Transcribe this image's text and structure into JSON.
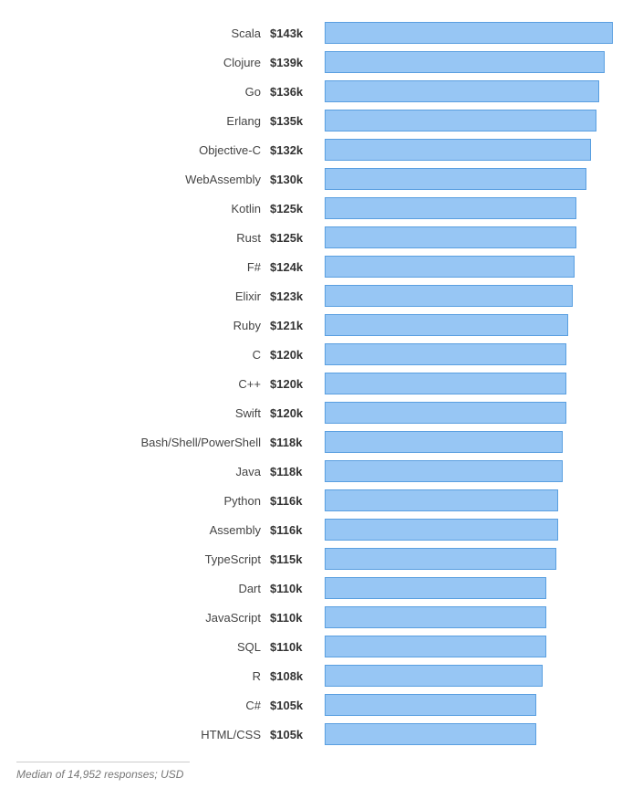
{
  "chart_data": {
    "type": "bar",
    "orientation": "horizontal",
    "unit": "USD",
    "value_prefix": "$",
    "value_suffix": "k",
    "max_value": 143,
    "categories": [
      "Scala",
      "Clojure",
      "Go",
      "Erlang",
      "Objective-C",
      "WebAssembly",
      "Kotlin",
      "Rust",
      "F#",
      "Elixir",
      "Ruby",
      "C",
      "C++",
      "Swift",
      "Bash/Shell/PowerShell",
      "Java",
      "Python",
      "Assembly",
      "TypeScript",
      "Dart",
      "JavaScript",
      "SQL",
      "R",
      "C#",
      "HTML/CSS"
    ],
    "values": [
      143,
      139,
      136,
      135,
      132,
      130,
      125,
      125,
      124,
      123,
      121,
      120,
      120,
      120,
      118,
      118,
      116,
      116,
      115,
      110,
      110,
      110,
      108,
      105,
      105
    ]
  },
  "footer_note": "Median of 14,952 responses; USD"
}
